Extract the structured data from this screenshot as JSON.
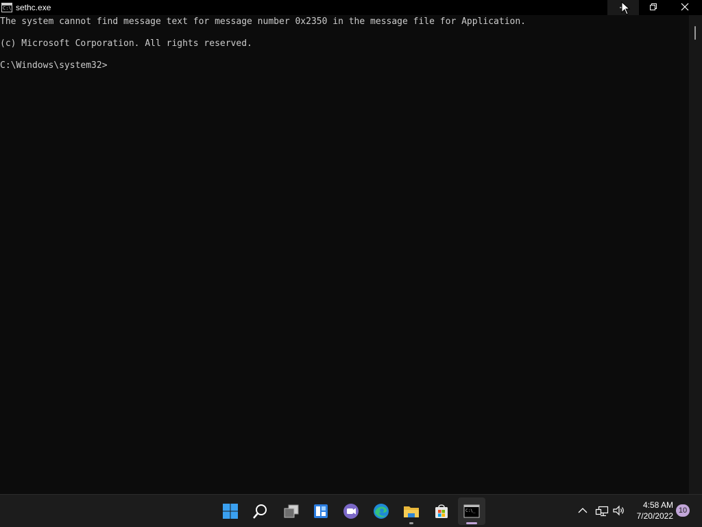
{
  "window": {
    "title": "sethc.exe",
    "icon": "cmd-icon",
    "controls": [
      "minimize",
      "maximize",
      "close"
    ]
  },
  "console": {
    "lines": [
      "The system cannot find message text for message number 0x2350 in the message file for Application.",
      "(c) Microsoft Corporation. All rights reserved.",
      "C:\\Windows\\system32>"
    ]
  },
  "taskbar": {
    "apps": [
      {
        "name": "start",
        "icon": "windows-logo-icon"
      },
      {
        "name": "search",
        "icon": "search-icon"
      },
      {
        "name": "task-view",
        "icon": "task-view-icon"
      },
      {
        "name": "widgets",
        "icon": "widgets-icon"
      },
      {
        "name": "chat",
        "icon": "teams-chat-icon"
      },
      {
        "name": "edge",
        "icon": "edge-browser-icon"
      },
      {
        "name": "file-explorer",
        "icon": "folder-icon"
      },
      {
        "name": "store",
        "icon": "store-icon"
      },
      {
        "name": "command-prompt",
        "icon": "terminal-icon",
        "active": true
      }
    ],
    "tray": {
      "time": "4:58 AM",
      "date": "7/20/2022",
      "notifications": "10"
    }
  },
  "colors": {
    "console_bg": "#0c0c0c",
    "console_text": "#cccccc",
    "taskbar_bg": "#1c1c1c",
    "accent": "#c2a6d9"
  }
}
